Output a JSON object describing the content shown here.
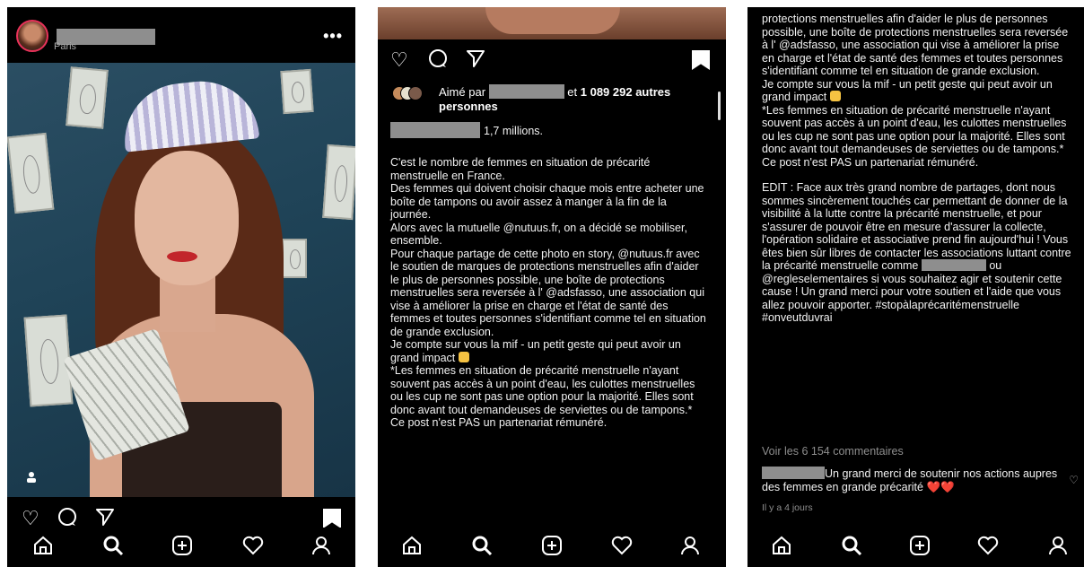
{
  "panel1": {
    "location": "Paris",
    "more_label": "•••"
  },
  "panel2": {
    "likes": {
      "prefix": "Aimé par",
      "suffix": "et ",
      "count_text": "1 089 292 autres personnes"
    },
    "caption_head": "1,7 millions.",
    "caption_paragraphs": [
      "C'est le nombre de femmes en situation de précarité menstruelle en France.",
      "Des femmes qui doivent choisir chaque mois entre acheter une boîte de tampons ou avoir assez à manger à la fin de la journée.",
      "Alors avec la mutuelle @nutuus.fr, on a décidé se mobiliser, ensemble.",
      "Pour chaque partage de cette photo en story, @nutuus.fr avec le soutien de marques de protections menstruelles afin d'aider le plus de personnes possible, une boîte de protections menstruelles sera reversée à l' @adsfasso, une association qui vise à améliorer la prise en charge et l'état de santé des femmes et toutes personnes s'identifiant comme tel en situation de grande exclusion.",
      "Je compte sur vous la mif - un petit geste qui peut avoir un grand impact",
      "*Les femmes en situation de précarité menstruelle n'ayant souvent pas accès à un point d'eau, les culottes menstruelles ou les cup ne sont pas une option pour la majorité. Elles sont donc avant tout demandeuses de serviettes ou de tampons.*",
      "Ce post n'est PAS un partenariat rémunéré."
    ]
  },
  "panel3": {
    "caption_paragraphs": [
      "protections menstruelles afin d'aider le plus de personnes possible, une boîte de protections menstruelles sera reversée à l' @adsfasso, une association qui vise à améliorer la prise en charge et l'état de santé des femmes et toutes personnes s'identifiant comme tel en situation de grande exclusion.",
      "Je compte sur vous la mif - un petit geste qui peut avoir un grand impact",
      "*Les femmes en situation de précarité menstruelle n'ayant souvent pas accès à un point d'eau, les culottes menstruelles ou les cup ne sont pas une option pour la majorité. Elles sont donc avant tout demandeuses de serviettes ou de tampons.*",
      "Ce post n'est PAS un partenariat rémunéré."
    ],
    "edit_before": "EDIT : Face aux très grand nombre de partages, dont nous sommes sincèrement touchés car permettant de donner de la visibilité à la lutte contre la précarité menstruelle, et pour s'assurer de pouvoir être en mesure d'assurer la collecte, l'opération solidaire et associative prend fin aujourd'hui ! Vous êtes bien sûr libres de contacter les associations luttant contre la précarité menstruelle comme",
    "edit_after": "ou @regleselementaires si vous souhaitez agir et soutenir cette cause ! Un grand merci pour votre soutien et l'aide que vous allez pouvoir apporter. #stopàlaprécaritémenstruelle #onveutduvrai",
    "comments_link": "Voir les 6 154 commentaires",
    "comment_text": "Un grand merci de soutenir nos actions aupres des femmes en grande précarité",
    "comment_hearts": "❤️❤️",
    "comment_time": "Il y a 4 jours"
  },
  "icons": {
    "like": "♡",
    "comment": "◯",
    "share": "▷",
    "home": "home-icon",
    "search": "search-icon",
    "add": "add-icon",
    "activity": "heart-icon",
    "profile": "profile-icon"
  },
  "colors": {
    "background": "#000000",
    "text": "#f2f2f2",
    "muted": "#8e8e8e",
    "redaction": "#8e8e8e",
    "heart_red": "#e02b2b"
  }
}
